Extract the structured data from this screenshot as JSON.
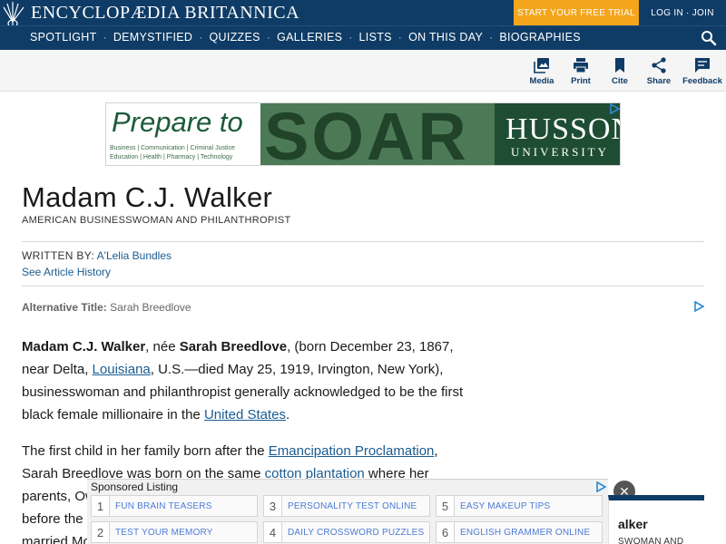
{
  "header": {
    "brand": "ENCYCLOPÆDIA BRITANNICA",
    "trial_button": "START YOUR FREE TRIAL",
    "login_button": "LOG IN · JOIN",
    "nav": [
      "SPOTLIGHT",
      "DEMYSTIFIED",
      "QUIZZES",
      "GALLERIES",
      "LISTS",
      "ON THIS DAY",
      "BIOGRAPHIES"
    ],
    "nav_separator": "·"
  },
  "toolbar": {
    "media": "Media",
    "print": "Print",
    "cite": "Cite",
    "share": "Share",
    "feedback": "Feedback"
  },
  "ad": {
    "prepare": "Prepare to",
    "tags_line1": "Business | Communication | Criminal Justice",
    "tags_line2": "Education | Health | Pharmacy | Technology",
    "soar": "SOAR",
    "husson": "HUSSON",
    "university": "UNIVERSITY"
  },
  "article": {
    "title": "Madam C.J. Walker",
    "subtitle": "AMERICAN BUSINESSWOMAN AND PHILANTHROPIST",
    "written_by_label": "WRITTEN BY:",
    "author": "A'Lelia Bundles",
    "history_link": "See Article History",
    "alt_title_label": "Alternative Title:",
    "alt_title_value": "Sarah Breedlove",
    "p1": {
      "name": "Madam C.J. Walker",
      "t1": ", née ",
      "birth_name": "Sarah Breedlove",
      "t2": ", (born December 23, 1867, near Delta, ",
      "link1": "Louisiana",
      "t3": ", U.S.—died May 25, 1919, Irvington, New York), businesswoman and philanthropist generally acknowledged to be the first black female millionaire in the ",
      "link2": "United States",
      "t4": "."
    },
    "p2": {
      "t1": "The first child in her family born after the ",
      "link1": "Emancipation Proclamation",
      "t2": ", Sarah Breedlove was born on the same ",
      "link2": "cotton",
      "t3": " ",
      "link3": "plantation",
      "t4": " where her parents, Ow",
      "line4": "before the",
      "line5": "married Mo"
    }
  },
  "sponsored": {
    "title": "Sponsored Listing",
    "items": [
      {
        "num": "1",
        "label": "FUN BRAIN TEASERS"
      },
      {
        "num": "3",
        "label": "PERSONALITY TEST ONLINE"
      },
      {
        "num": "5",
        "label": "EASY MAKEUP TIPS"
      },
      {
        "num": "2",
        "label": "TEST YOUR MEMORY"
      },
      {
        "num": "4",
        "label": "DAILY CROSSWORD PUZZLES"
      },
      {
        "num": "6",
        "label": "ENGLISH GRAMMER ONLINE"
      }
    ],
    "close": "✕"
  },
  "side_card": {
    "name": "alker",
    "sub": "SWOMAN AND"
  },
  "colors": {
    "header_bg": "#0f3c66",
    "trial_bg": "#f4a51c",
    "link": "#1a5c91"
  }
}
